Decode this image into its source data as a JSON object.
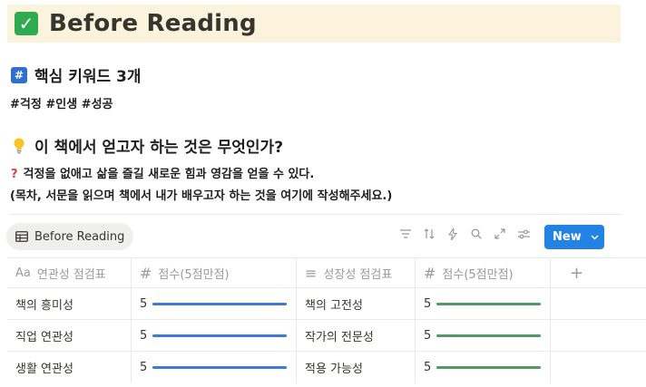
{
  "title": {
    "text": "Before Reading",
    "icon": "check-icon"
  },
  "section1": {
    "heading": "핵심 키워드 3개",
    "icon": "hash-icon",
    "keywords": "#걱정 #인생 #성공"
  },
  "section2": {
    "heading": "이 책에서 얻고자 하는 것은 무엇인가?",
    "icon": "lightbulb-icon",
    "answer": "걱정을 없애고 삶을 즐길 새로운 힘과 영감을 얻을 수 있다.",
    "answer_mark": "?",
    "note": "(목차, 서문을 읽으며 책에서 내가 배우고자 하는 것을 여기에 작성해주세요.)"
  },
  "database": {
    "view_tab": "Before Reading",
    "new_button": "New",
    "columns": [
      {
        "icon": "Aa",
        "label": "연관성 점검표"
      },
      {
        "icon": "#",
        "label": "점수(5점만점)"
      },
      {
        "icon": "≡",
        "label": "성장성 점검표"
      },
      {
        "icon": "#",
        "label": "점수(5점만점)"
      }
    ],
    "rows": [
      {
        "relevance": "책의 흥미성",
        "score1": "5",
        "growth": "책의 고전성",
        "score2": "5"
      },
      {
        "relevance": "직업 연관성",
        "score1": "5",
        "growth": "작가의 전문성",
        "score2": "5"
      },
      {
        "relevance": "생활 연관성",
        "score1": "5",
        "growth": "적용 가능성",
        "score2": "5"
      }
    ],
    "score_max": 5,
    "colors": {
      "bar_blue": "#3b7ad8",
      "bar_green": "#4f9a65",
      "new_button": "#2383e2"
    }
  }
}
